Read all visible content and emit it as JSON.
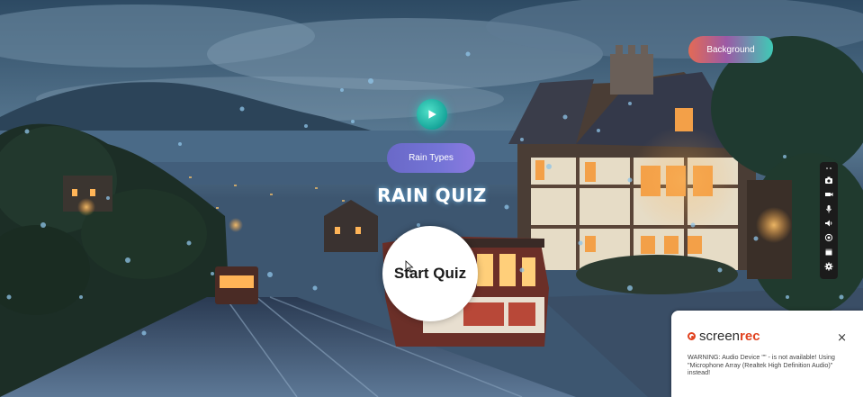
{
  "buttons": {
    "background_label": "Background",
    "rain_types_label": "Rain Types",
    "start_quiz_label": "Start Quiz"
  },
  "title": "RAIN QUIZ",
  "icons": {
    "play": "play-icon",
    "toolbar": [
      "grip-icon",
      "camera-icon",
      "video-icon",
      "microphone-icon",
      "speaker-icon",
      "webcam-icon",
      "window-icon",
      "gear-icon"
    ]
  },
  "screenrec": {
    "brand_prefix": "screen",
    "brand_suffix": "rec",
    "close_label": "×",
    "warning": "WARNING: Audio Device \"\" - is not available! Using \"Microphone Array (Realtek High Definition Audio)\" instead!"
  },
  "colors": {
    "teal": "#1ba89c",
    "pill_purple": "#7474d6",
    "screenrec_red": "#e1421f"
  }
}
